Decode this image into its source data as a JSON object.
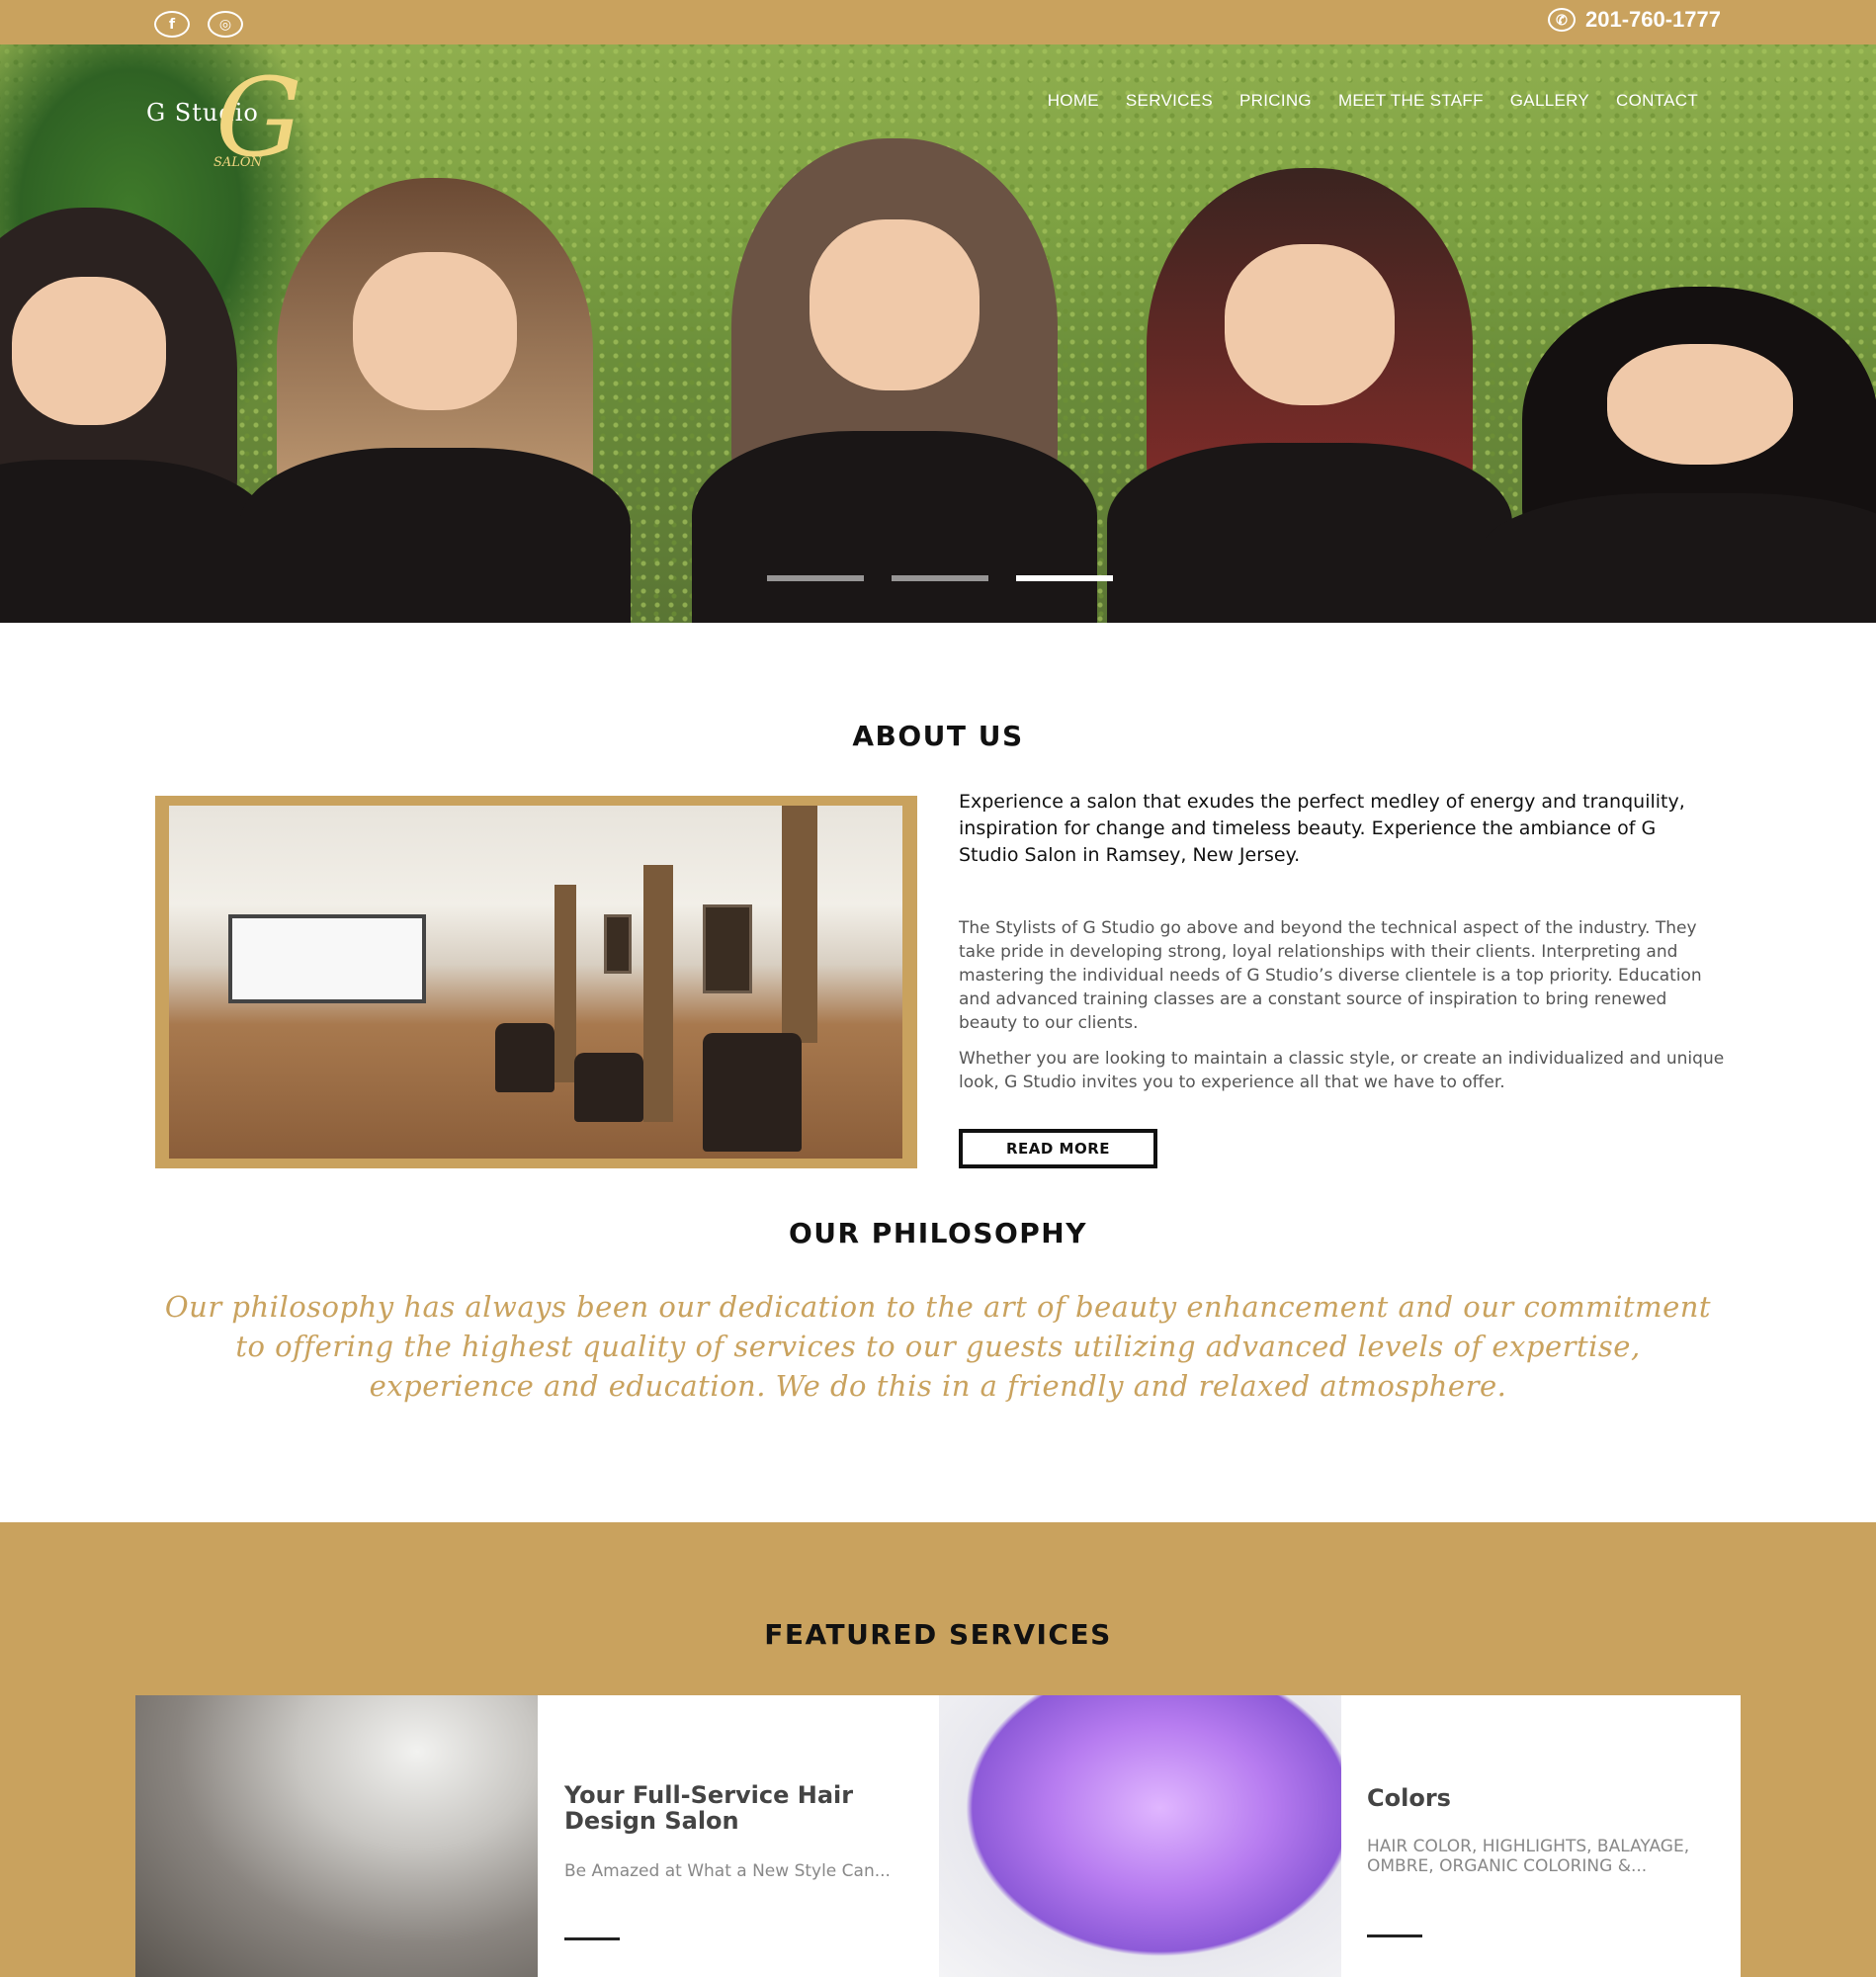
{
  "topbar": {
    "facebook_icon": "f",
    "instagram_icon": "◎",
    "phone_icon": "✆",
    "phone": "201-760-1777"
  },
  "hero": {
    "logo": {
      "name": "G Studio",
      "letter": "G",
      "salon": "SALON"
    },
    "nav": [
      "HOME",
      "SERVICES",
      "PRICING",
      "MEET THE STAFF",
      "GALLERY",
      "CONTACT"
    ],
    "slider": {
      "slides": 3,
      "active": 3
    }
  },
  "about": {
    "title": "ABOUT US",
    "lead": "Experience a salon that exudes the perfect medley of energy and tranquility, inspiration for change and timeless beauty. Experience the ambiance of G Studio Salon in Ramsey, New Jersey.",
    "paragraph1": "The Stylists of G Studio go above and beyond the technical aspect of the industry. They take pride in developing strong, loyal relationships with their clients. Interpreting and mastering the individual needs of G Studio’s diverse clientele is a top priority. Education and advanced training classes are a constant source of inspiration to bring renewed beauty to our clients.",
    "paragraph2": "Whether you are looking to maintain a classic style, or create an individualized and unique look, G Studio invites you to experience all that we have to offer.",
    "button": "READ MORE"
  },
  "philosophy": {
    "title": "OUR PHILOSOPHY",
    "text": "Our philosophy has always been our dedication to the art of beauty enhancement and our commitment to offering the highest quality of services to our guests utilizing advanced levels of expertise, experience and education. We do this in a friendly and relaxed atmosphere."
  },
  "featured": {
    "title": "FEATURED SERVICES",
    "cards": [
      {
        "title": "Your Full-Service Hair Design Salon",
        "text": "Be Amazed at What a New Style Can..."
      },
      {
        "title": "Colors",
        "text": "HAIR COLOR, HIGHLIGHTS, BALAYAGE, OMBRE, ORGANIC COLORING &..."
      }
    ]
  },
  "colors": {
    "accent": "#c9a25e",
    "text": "#111111",
    "muted": "#555555"
  }
}
